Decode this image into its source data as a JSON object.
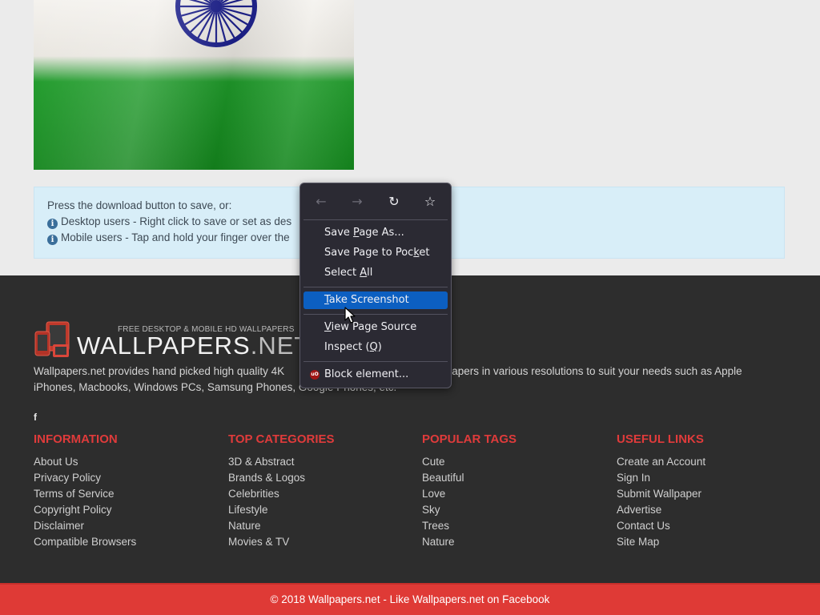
{
  "info": {
    "line1": "Press the download button to save, or:",
    "line2": "Desktop users - Right click to save or set as des",
    "line3": "Mobile users - Tap and hold your finger over the",
    "icon": "info-circle-icon"
  },
  "footer": {
    "logo": {
      "tagline": "FREE DESKTOP & MOBILE HD WALLPAPERS",
      "name_main": "WALLPAPERS",
      "name_suffix": ".NET"
    },
    "description_left": "Wallpapers.net provides hand picked high quality 4K",
    "description_right": "allpapers in various resolutions to suit your needs such as Apple",
    "description_line2": "iPhones, Macbooks, Windows PCs, Samsung Phones, Google Phones, etc.",
    "social_icon": "f",
    "columns": [
      {
        "title": "INFORMATION",
        "links": [
          "About Us",
          "Privacy Policy",
          "Terms of Service",
          "Copyright Policy",
          "Disclaimer",
          "Compatible Browsers"
        ]
      },
      {
        "title": "TOP CATEGORIES",
        "links": [
          "3D & Abstract",
          "Brands & Logos",
          "Celebrities",
          "Lifestyle",
          "Nature",
          "Movies & TV"
        ]
      },
      {
        "title": "POPULAR TAGS",
        "links": [
          "Cute",
          "Beautiful",
          "Love",
          "Sky",
          "Trees",
          "Nature"
        ]
      },
      {
        "title": "USEFUL LINKS",
        "links": [
          "Create an Account",
          "Sign In",
          "Submit Wallpaper",
          "Advertise",
          "Contact Us",
          "Site Map"
        ]
      }
    ],
    "copyright": "© 2018 Wallpapers.net - Like Wallpapers.net on Facebook"
  },
  "context_menu": {
    "nav": {
      "back": "←",
      "forward": "→",
      "reload": "↻",
      "bookmark": "☆"
    },
    "items": [
      {
        "pre": "Save ",
        "key": "P",
        "post": "age As..."
      },
      {
        "pre": "Save Page to Poc",
        "key": "k",
        "post": "et"
      },
      {
        "pre": "Select ",
        "key": "A",
        "post": "ll"
      },
      {
        "pre": "",
        "key": "T",
        "post": "ake Screenshot"
      },
      {
        "pre": "",
        "key": "V",
        "post": "iew Page Source"
      },
      {
        "pre": "Inspect (",
        "key": "Q",
        "post": ")"
      },
      {
        "pre": "Block element...",
        "key": "",
        "post": ""
      }
    ],
    "ublock_badge": "uO",
    "highlight_color": "#0c5fc1"
  },
  "colors": {
    "footer_bg": "#2d2d2d",
    "accent_red": "#df3a36",
    "info_bg": "#d8eef8"
  }
}
